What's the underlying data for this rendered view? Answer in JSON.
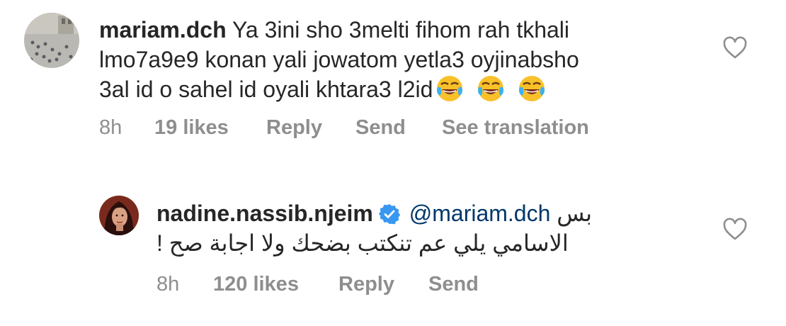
{
  "comments": [
    {
      "username": "mariam.dch",
      "text_lines": [
        "Ya 3ini sho 3melti fihom rah tkhali",
        "lmo7a9e9 konan yali jowatom yetla3 oyjinabsho",
        "3al id o sahel id oyali khtara3 l2id"
      ],
      "emoji_icons": [
        "tears-of-joy-icon",
        "tears-of-joy-icon",
        "tears-of-joy-icon"
      ],
      "time": "8h",
      "likes": "19 likes",
      "reply": "Reply",
      "send": "Send",
      "translate": "See translation"
    },
    {
      "username": "nadine.nassib.njeim",
      "verified": true,
      "mention": "@mariam.dch",
      "text_line1_rtl": "بس",
      "text_line2": "! الاسامي يلي عم تنكتب بضحك ولا اجابة صح",
      "time": "8h",
      "likes": "120 likes",
      "reply": "Reply",
      "send": "Send"
    }
  ],
  "colors": {
    "text": "#262626",
    "meta": "#8e8e8e",
    "mention": "#00376b",
    "verified": "#3897f0"
  }
}
